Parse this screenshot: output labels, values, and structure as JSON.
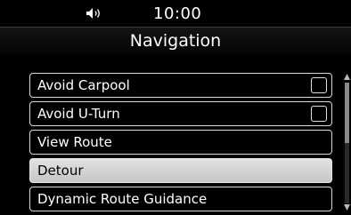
{
  "status_bar": {
    "time": "10:00",
    "volume_icon": "speaker-icon"
  },
  "header": {
    "title": "Navigation"
  },
  "menu": {
    "items": [
      {
        "label": "Avoid Carpool",
        "checkbox": true,
        "checked": false
      },
      {
        "label": "Avoid U-Turn",
        "checkbox": true,
        "checked": false
      },
      {
        "label": "View Route",
        "checkbox": false
      },
      {
        "label": "Detour",
        "checkbox": false,
        "selected": true
      },
      {
        "label": "Dynamic Route Guidance",
        "checkbox": false
      }
    ]
  },
  "scrollbar": {
    "position_fraction": 0.0,
    "visible_fraction": 0.5
  }
}
